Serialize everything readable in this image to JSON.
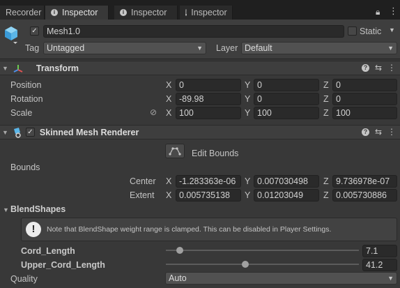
{
  "tabs": [
    {
      "label": "Recorder",
      "active": false
    },
    {
      "label": "Inspector",
      "active": true
    },
    {
      "label": "Inspector",
      "active": false
    },
    {
      "label": "Inspector",
      "active": false
    }
  ],
  "gameobject": {
    "name": "Mesh1.0",
    "active": true,
    "static_label": "Static",
    "static_checked": false,
    "tag_label": "Tag",
    "tag_value": "Untagged",
    "layer_label": "Layer",
    "layer_value": "Default"
  },
  "transform": {
    "title": "Transform",
    "rows": [
      {
        "label": "Position",
        "x": "0",
        "y": "0",
        "z": "0"
      },
      {
        "label": "Rotation",
        "x": "-89.98",
        "y": "0",
        "z": "0"
      },
      {
        "label": "Scale",
        "x": "100",
        "y": "100",
        "z": "100"
      }
    ],
    "axes": [
      "X",
      "Y",
      "Z"
    ]
  },
  "skinned_mesh_renderer": {
    "title": "Skinned Mesh Renderer",
    "enabled": true,
    "edit_bounds_label": "Edit Bounds",
    "bounds_label": "Bounds",
    "center_label": "Center",
    "center": {
      "x": "-1.283363e-06",
      "y": "0.007030498",
      "z": "9.736978e-07"
    },
    "extent_label": "Extent",
    "extent": {
      "x": "0.005735138",
      "y": "0.01203049",
      "z": "0.005730886"
    },
    "blendshapes_label": "BlendShapes",
    "blendshape_note": "Note that BlendShape weight range is clamped. This can be disabled in Player Settings.",
    "blendshapes": [
      {
        "name": "Cord_Length",
        "value": "7.1",
        "fraction": 0.071
      },
      {
        "name": "Upper_Cord_Length",
        "value": "41.2",
        "fraction": 0.412
      }
    ],
    "quality_label": "Quality",
    "quality_value": "Auto"
  },
  "colors": {
    "background": "#383838",
    "header": "#3e3e3e",
    "field": "#2a2a2a",
    "tabbar": "#1f1f1f"
  }
}
